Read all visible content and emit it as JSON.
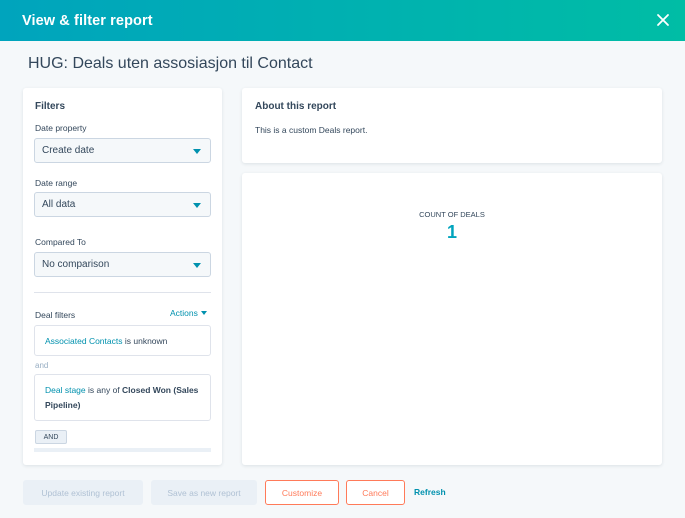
{
  "header": {
    "title": "View & filter report"
  },
  "page": {
    "title": "HUG: Deals uten assosiasjon til Contact"
  },
  "filters": {
    "heading": "Filters",
    "date_property": {
      "label": "Date property",
      "value": "Create date"
    },
    "date_range": {
      "label": "Date range",
      "value": "All data"
    },
    "compared_to": {
      "label": "Compared To",
      "value": "No comparison"
    },
    "deal_filters": {
      "label": "Deal filters",
      "actions_label": "Actions",
      "rules": [
        {
          "property": "Associated Contacts",
          "operator": "is unknown",
          "value": ""
        },
        {
          "property": "Deal stage",
          "operator": "is any of",
          "value": "Closed Won (Sales Pipeline)"
        }
      ],
      "joiner": "and",
      "and_button": "AND"
    }
  },
  "about": {
    "title": "About this report",
    "description": "This is a custom Deals report."
  },
  "metric": {
    "label": "COUNT OF DEALS",
    "value": "1"
  },
  "footer": {
    "update_label": "Update existing report",
    "save_new_label": "Save as new report",
    "customize_label": "Customize",
    "cancel_label": "Cancel",
    "refresh_label": "Refresh"
  },
  "colors": {
    "accent": "#00a4bd",
    "link": "#0091ae",
    "cta": "#ff7a59"
  }
}
